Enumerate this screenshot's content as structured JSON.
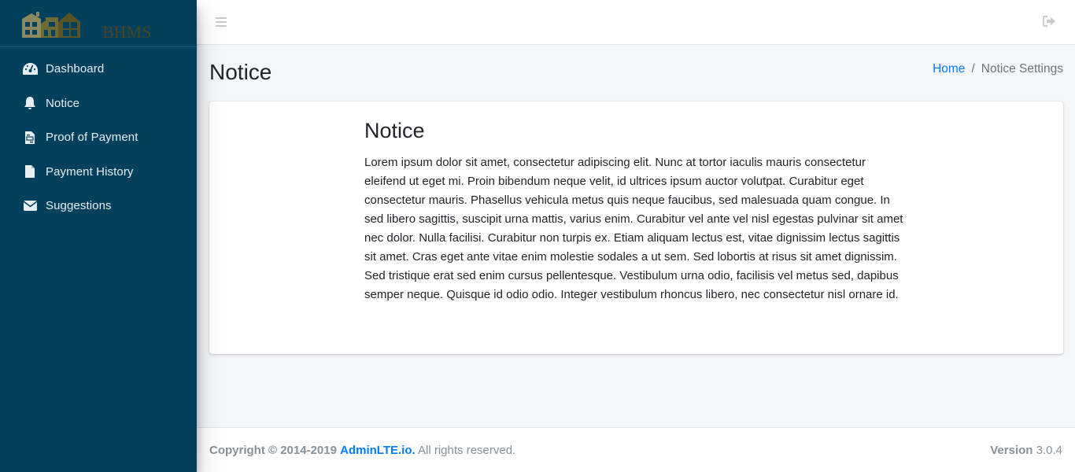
{
  "brand": {
    "name": "BHMS",
    "logo_icon": "houses-logo-icon"
  },
  "sidebar": {
    "items": [
      {
        "label": "Dashboard",
        "icon": "tachometer-icon"
      },
      {
        "label": "Notice",
        "icon": "bell-icon"
      },
      {
        "label": "Proof of Payment",
        "icon": "file-invoice-icon"
      },
      {
        "label": "Payment History",
        "icon": "file-icon"
      },
      {
        "label": "Suggestions",
        "icon": "envelope-icon"
      }
    ]
  },
  "topbar": {
    "menu_icon": "hamburger-icon",
    "logout_icon": "sign-out-icon"
  },
  "header": {
    "title": "Notice",
    "breadcrumb": {
      "home": "Home",
      "separator": "/",
      "current": "Notice Settings"
    }
  },
  "notice": {
    "title": "Notice",
    "body": "Lorem ipsum dolor sit amet, consectetur adipiscing elit. Nunc at tortor iaculis mauris consectetur eleifend ut eget mi. Proin bibendum neque velit, id ultrices ipsum auctor volutpat. Curabitur eget consectetur mauris. Phasellus vehicula metus quis neque faucibus, sed malesuada quam congue. In sed libero sagittis, suscipit urna mattis, varius enim. Curabitur vel ante vel nisl egestas pulvinar sit amet nec dolor. Nulla facilisi. Curabitur non turpis ex. Etiam aliquam lectus est, vitae dignissim lectus sagittis sit amet. Cras eget ante vitae enim molestie sodales a ut sem. Sed lobortis at risus sit amet dignissim. Sed tristique erat sed enim cursus pellentesque. Vestibulum urna odio, facilisis vel metus sed, dapibus semper neque. Quisque id odio odio. Integer vestibulum rhoncus libero, nec consectetur nisl ornare id."
  },
  "footer": {
    "copyright_prefix": "Copyright © 2014-2019",
    "link": "AdminLTE.io.",
    "suffix": "All rights reserved.",
    "version_label": "Version",
    "version": "3.0.4"
  },
  "colors": {
    "sidebar_bg": "#03405e",
    "link": "#007bff",
    "content_bg": "#f4f6f9"
  }
}
